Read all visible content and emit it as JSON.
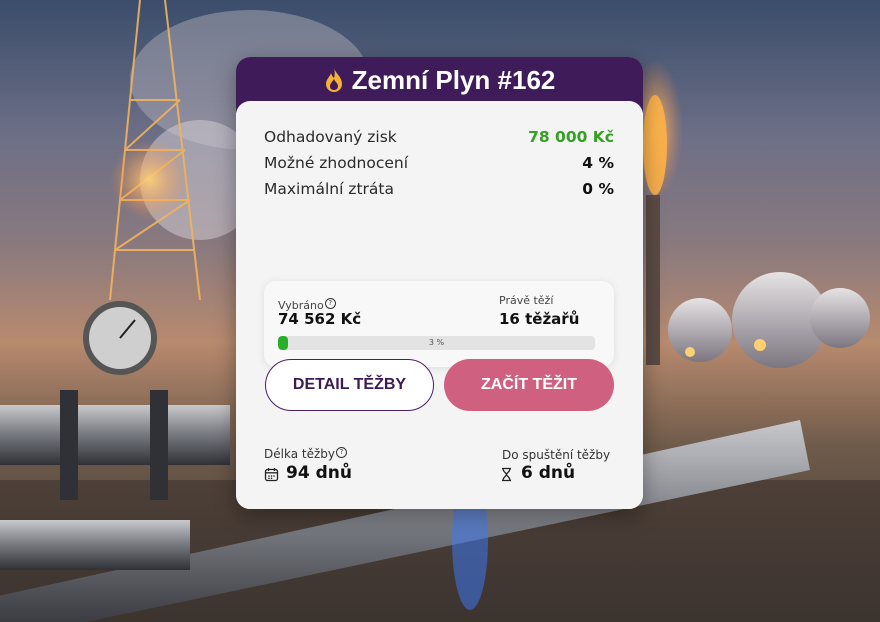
{
  "card": {
    "title": "Zemní Plyn #162",
    "title_icon": "flame-icon",
    "header_color": "#3f1b5a",
    "details": [
      {
        "label": "Odhadovaný zisk",
        "value": "78 000 Kč",
        "highlight": "#35a024"
      },
      {
        "label": "Možné zhodnocení",
        "value": "4 %"
      },
      {
        "label": "Maximální ztráta",
        "value": "0 %"
      }
    ],
    "stats": {
      "collected_label": "Vybráno",
      "collected_value": "74 562 Kč",
      "miners_label": "Právě těží",
      "miners_value": "16 těžařů",
      "progress_percent": 3,
      "progress_label": "3 %",
      "progress_color": "#28b028"
    },
    "buttons": {
      "detail_label": "DETAIL TĚŽBY",
      "start_label": "ZAČÍT TĚŽIT",
      "start_color": "#d0607f"
    },
    "footer": {
      "duration_label": "Délka těžby",
      "duration_value": "94 dnů",
      "duration_icon": "calendar-icon",
      "countdown_label": "Do spuštění těžby",
      "countdown_value": "6 dnů",
      "countdown_icon": "hourglass-icon"
    }
  }
}
